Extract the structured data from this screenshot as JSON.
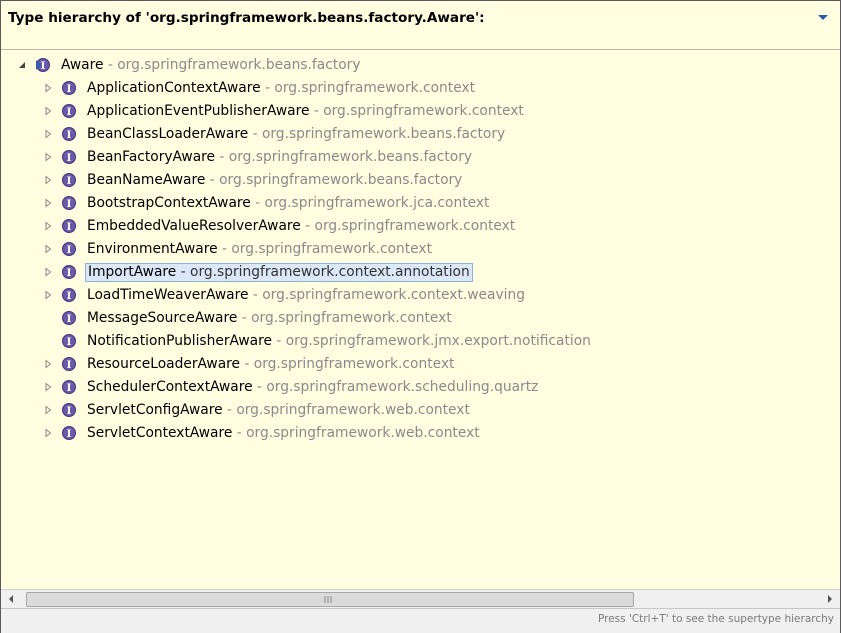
{
  "header": {
    "title": "Type hierarchy of 'org.springframework.beans.factory.Aware':"
  },
  "tree": {
    "root": {
      "name": "Aware",
      "package": "org.springframework.beans.factory",
      "expanded": true,
      "icon": "interface-icon"
    },
    "children": [
      {
        "name": "ApplicationContextAware",
        "package": "org.springframework.context",
        "expandable": true
      },
      {
        "name": "ApplicationEventPublisherAware",
        "package": "org.springframework.context",
        "expandable": true
      },
      {
        "name": "BeanClassLoaderAware",
        "package": "org.springframework.beans.factory",
        "expandable": true
      },
      {
        "name": "BeanFactoryAware",
        "package": "org.springframework.beans.factory",
        "expandable": true
      },
      {
        "name": "BeanNameAware",
        "package": "org.springframework.beans.factory",
        "expandable": true
      },
      {
        "name": "BootstrapContextAware",
        "package": "org.springframework.jca.context",
        "expandable": true
      },
      {
        "name": "EmbeddedValueResolverAware",
        "package": "org.springframework.context",
        "expandable": true
      },
      {
        "name": "EnvironmentAware",
        "package": "org.springframework.context",
        "expandable": true
      },
      {
        "name": "ImportAware",
        "package": "org.springframework.context.annotation",
        "expandable": true,
        "selected": true
      },
      {
        "name": "LoadTimeWeaverAware",
        "package": "org.springframework.context.weaving",
        "expandable": true
      },
      {
        "name": "MessageSourceAware",
        "package": "org.springframework.context",
        "expandable": false
      },
      {
        "name": "NotificationPublisherAware",
        "package": "org.springframework.jmx.export.notification",
        "expandable": false
      },
      {
        "name": "ResourceLoaderAware",
        "package": "org.springframework.context",
        "expandable": true
      },
      {
        "name": "SchedulerContextAware",
        "package": "org.springframework.scheduling.quartz",
        "expandable": true
      },
      {
        "name": "ServletConfigAware",
        "package": "org.springframework.web.context",
        "expandable": true
      },
      {
        "name": "ServletContextAware",
        "package": "org.springframework.web.context",
        "expandable": true
      }
    ]
  },
  "separator": " - ",
  "status": {
    "hint": "Press 'Ctrl+T' to see the supertype hierarchy"
  },
  "colors": {
    "background": "#fffee0",
    "interface_icon": "#6a5aa8",
    "selection": "#dbe8f8",
    "package_text": "#8a8a8a"
  }
}
